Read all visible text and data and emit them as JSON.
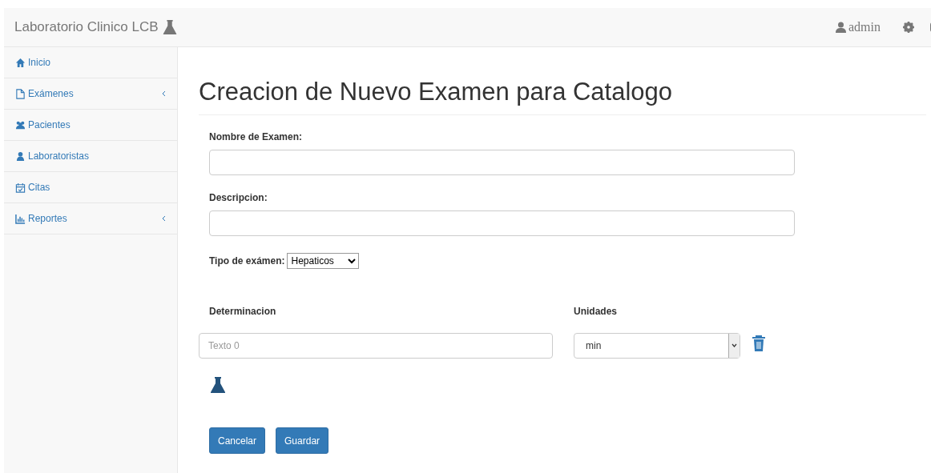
{
  "navbar": {
    "brand": "Laboratorio Clinico LCB",
    "user": "admin"
  },
  "sidebar": {
    "items": [
      {
        "label": "Inicio",
        "kind": "home",
        "expandable": false
      },
      {
        "label": "Exámenes",
        "kind": "file",
        "expandable": true
      },
      {
        "label": "Pacientes",
        "kind": "users",
        "expandable": false
      },
      {
        "label": "Laboratoristas",
        "kind": "staff",
        "expandable": false
      },
      {
        "label": "Citas",
        "kind": "calendar",
        "expandable": false
      },
      {
        "label": "Reportes",
        "kind": "chart",
        "expandable": true
      }
    ]
  },
  "page": {
    "title": "Creacion de Nuevo Examen para Catalogo",
    "fields": [
      {
        "label": "Nombre de Examen:"
      },
      {
        "label": "Descripcion:"
      }
    ],
    "type_select": {
      "label": "Tipo de exámen:",
      "value": "Hepaticos"
    },
    "determinations": {
      "columns": [
        "Determinacion",
        "Unidades"
      ],
      "rows": [
        {
          "placeholder": "Texto 0",
          "unit": "min"
        }
      ]
    },
    "buttons": [
      "Cancelar",
      "Guardar"
    ]
  }
}
